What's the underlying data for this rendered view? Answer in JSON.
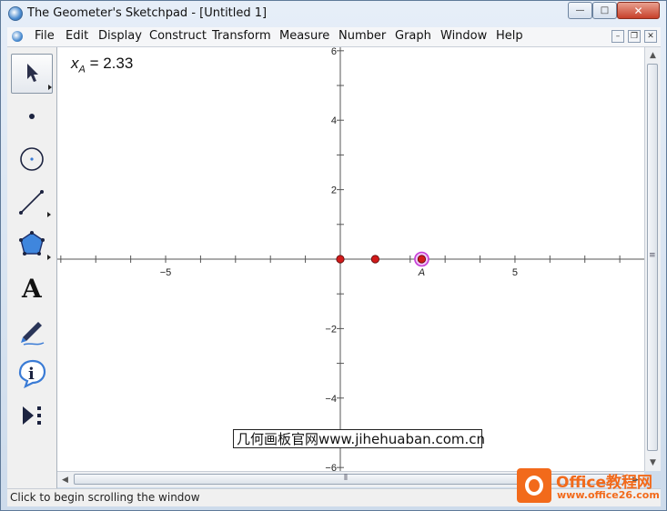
{
  "window": {
    "title": "The Geometer's Sketchpad - [Untitled 1]",
    "minimize": "—",
    "maximize": "□",
    "close": "✕"
  },
  "menu": {
    "items": [
      "File",
      "Edit",
      "Display",
      "Construct",
      "Transform",
      "Measure",
      "Number",
      "Graph",
      "Window",
      "Help"
    ],
    "mdi_minimize": "–",
    "mdi_restore": "❐",
    "mdi_close": "✕"
  },
  "toolbox": {
    "tools": [
      {
        "name": "arrow-tool-icon",
        "selected": true
      },
      {
        "name": "point-tool-icon"
      },
      {
        "name": "compass-tool-icon"
      },
      {
        "name": "straightedge-tool-icon"
      },
      {
        "name": "polygon-tool-icon"
      },
      {
        "name": "text-tool-icon",
        "glyph": "A"
      },
      {
        "name": "marker-tool-icon"
      },
      {
        "name": "information-tool-icon"
      },
      {
        "name": "custom-tool-icon"
      }
    ]
  },
  "measurement": {
    "variable": "x",
    "subscript": "A",
    "value": "= 2.33"
  },
  "graph": {
    "x_range": [
      -8.1,
      8.7
    ],
    "y_range": [
      -6.1,
      6.1
    ],
    "x_tick_labels": [
      "−5",
      "5"
    ],
    "y_tick_labels": [
      "6",
      "4",
      "2",
      "−2",
      "−4",
      "−6"
    ],
    "points": [
      {
        "x": 0,
        "y": 0,
        "color": "#d11a1a"
      },
      {
        "x": 1,
        "y": 0,
        "color": "#d11a1a"
      },
      {
        "x": 2.33,
        "y": 0,
        "color": "#d11a1a",
        "selected": true,
        "label": "A"
      }
    ]
  },
  "caption": "几何画板官网www.jihehuaban.com.cn",
  "status": "Click to begin scrolling the window",
  "watermark": {
    "title": "Office教程网",
    "url": "www.office26.com"
  },
  "colors": {
    "point": "#d11a1a",
    "selection": "#c43bd6",
    "caption_accent": "#ff9a2e",
    "watermark": "#f26a1b"
  }
}
